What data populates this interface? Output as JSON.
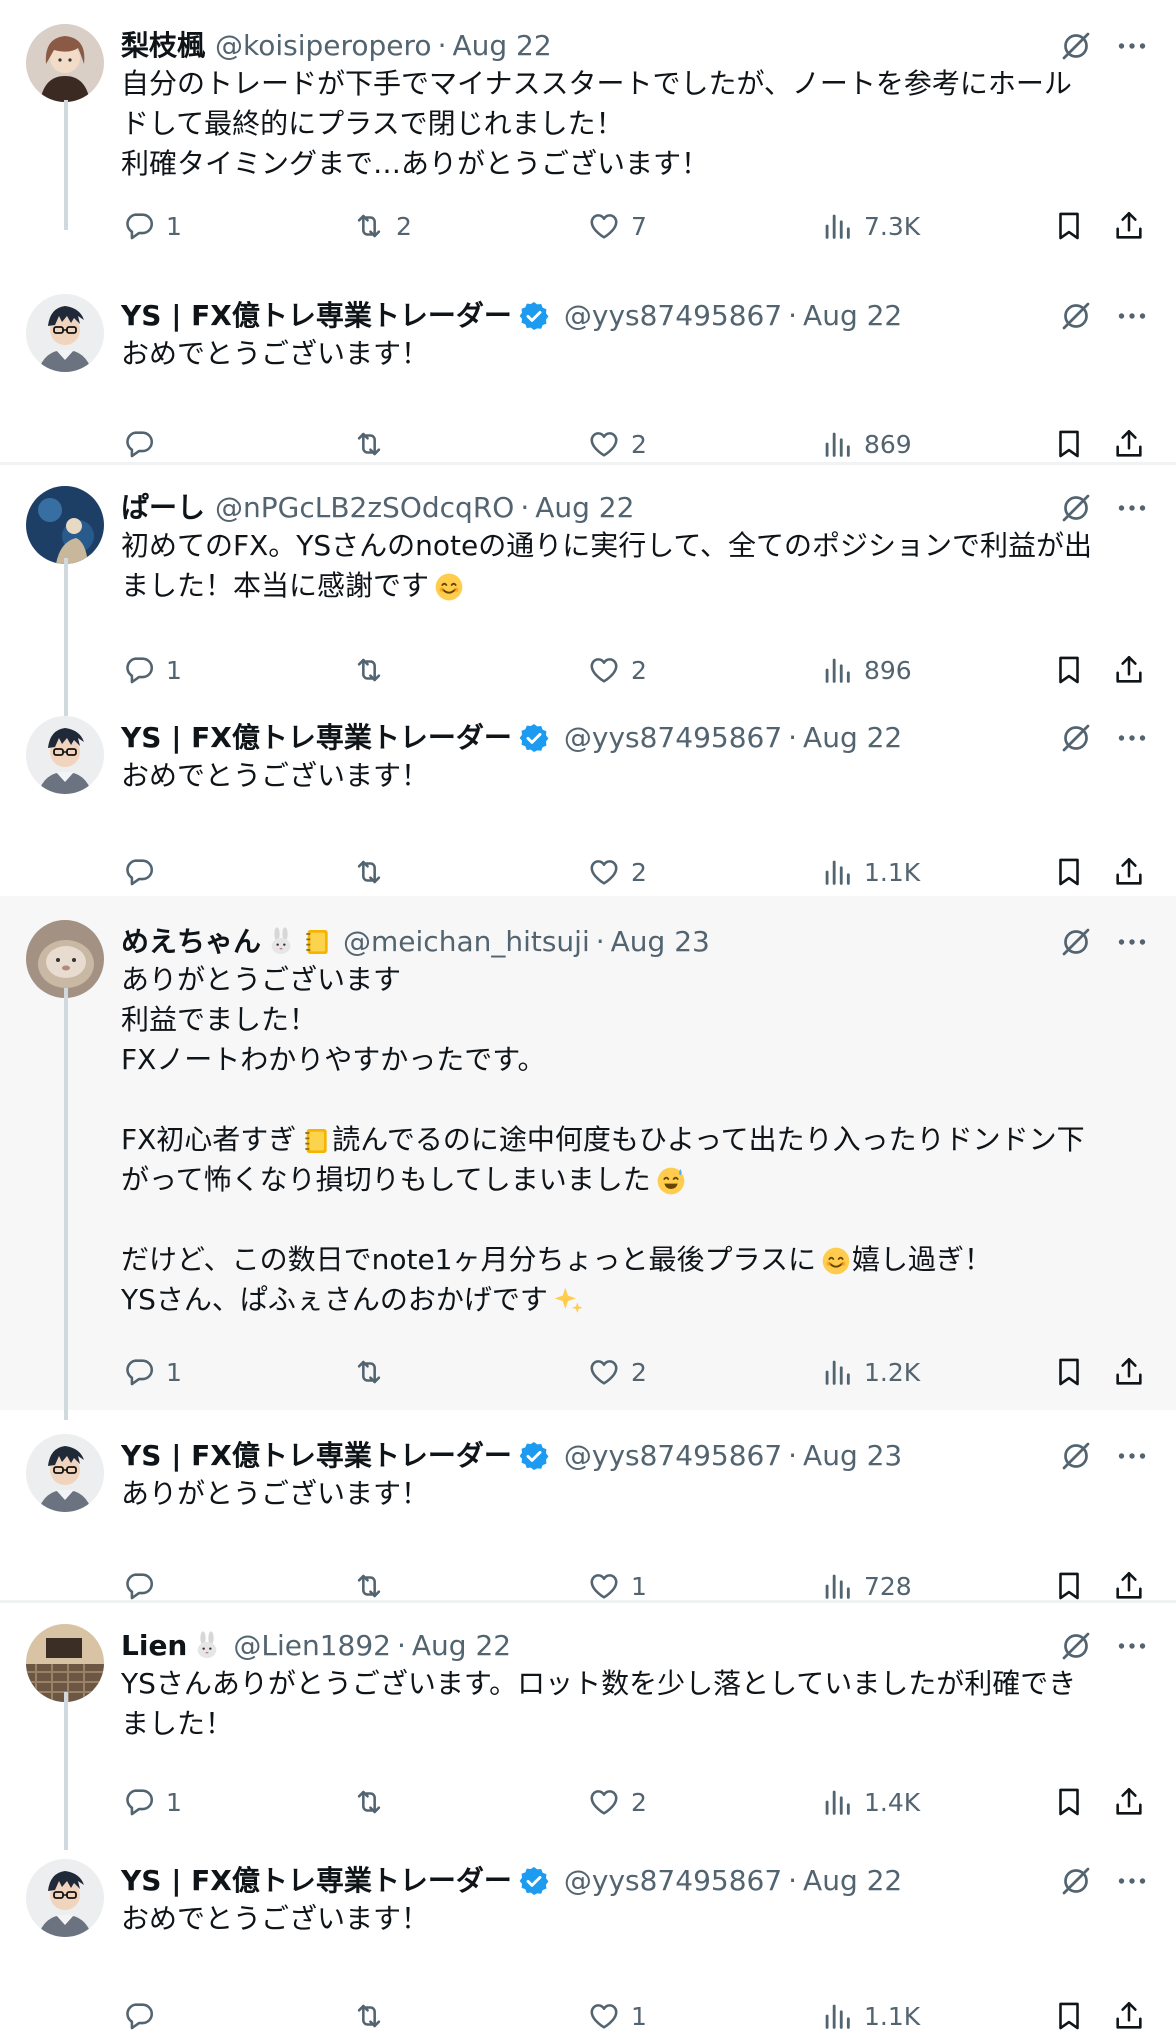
{
  "feed": {
    "tweets": [
      {
        "name": "梨枝楓",
        "handle": "@koisiperopero",
        "dot": "·",
        "date": "Aug 22",
        "text": "自分のトレードが下手でマイナススタートでしたが、ノートを参考にホール\nドして最終的にプラスで閉じれました！\n利確タイミングまで…ありがとうございます！",
        "replies": "1",
        "retweets": "2",
        "likes": "7",
        "views": "7.3K",
        "verified": false,
        "avatar_bg": "#8a5a44"
      },
      {
        "name": "YS | FX億トレ専業トレーダー",
        "handle": "@yys87495867",
        "dot": "·",
        "date": "Aug 22",
        "text": "おめでとうございます！",
        "replies": "",
        "retweets": "",
        "likes": "2",
        "views": "869",
        "verified": true,
        "avatar_bg": "#e7e9ea"
      },
      {
        "name": "ぱーし",
        "handle": "@nPGcLB2zSOdcqRO",
        "dot": "·",
        "date": "Aug 22",
        "text": "初めてのFX。YSさんのnoteの通りに実行して、全てのポジションで利益が出\nました！本当に感謝です",
        "replies": "1",
        "retweets": "",
        "likes": "2",
        "views": "896",
        "verified": false,
        "avatar_bg": "#1d3f66"
      },
      {
        "name": "YS | FX億トレ専業トレーダー",
        "handle": "@yys87495867",
        "dot": "·",
        "date": "Aug 22",
        "text": "おめでとうございます！",
        "replies": "",
        "retweets": "",
        "likes": "2",
        "views": "1.1K",
        "verified": true,
        "avatar_bg": "#e7e9ea"
      },
      {
        "name": "めえちゃん",
        "handle": "@meichan_hitsuji",
        "dot": "·",
        "date": "Aug 23",
        "text": "ありがとうございます\n利益でました！\nFXノートわかりやすかったです。\n\nFX初心者すぎ　読んでるのに途中何度もひよって出たり入ったりドンドン下\nがって怖くなり損切りもしてしまいました\n\nだけど、この数日でnote1ヶ月分ちょっと最後プラスに　嬉し過ぎ！\nYSさん、ぱふぇさんのおかげです",
        "replies": "1",
        "retweets": "",
        "likes": "2",
        "views": "1.2K",
        "verified": false,
        "avatar_bg": "#c9b8a3"
      },
      {
        "name": "YS | FX億トレ専業トレーダー",
        "handle": "@yys87495867",
        "dot": "·",
        "date": "Aug 23",
        "text": "ありがとうございます！",
        "replies": "",
        "retweets": "",
        "likes": "1",
        "views": "728",
        "verified": true,
        "avatar_bg": "#e7e9ea"
      },
      {
        "name": "Lien",
        "handle": "@Lien1892",
        "dot": "·",
        "date": "Aug 22",
        "text": "YSさんありがとうございます。ロット数を少し落としていましたが利確でき\nました！",
        "replies": "1",
        "retweets": "",
        "likes": "2",
        "views": "1.4K",
        "verified": false,
        "avatar_bg": "#6b5744"
      },
      {
        "name": "YS | FX億トレ専業トレーダー",
        "handle": "@yys87495867",
        "dot": "·",
        "date": "Aug 22",
        "text": "おめでとうございます！",
        "replies": "",
        "retweets": "",
        "likes": "1",
        "views": "1.1K",
        "verified": true,
        "avatar_bg": "#e7e9ea"
      }
    ]
  },
  "colors": {
    "text": "#0f1419",
    "muted": "#536471",
    "verified": "#1d9bf0",
    "thread_line": "#cfd9de",
    "highlight_bg": "#f7f7f7",
    "divider": "#eff3f4"
  },
  "icons": {
    "reply": "reply-icon",
    "retweet": "retweet-icon",
    "like": "heart-icon",
    "views": "views-icon",
    "bookmark": "bookmark-icon",
    "share": "share-icon",
    "grok": "grok-icon",
    "more": "more-icon",
    "verified": "verified-badge-icon"
  }
}
